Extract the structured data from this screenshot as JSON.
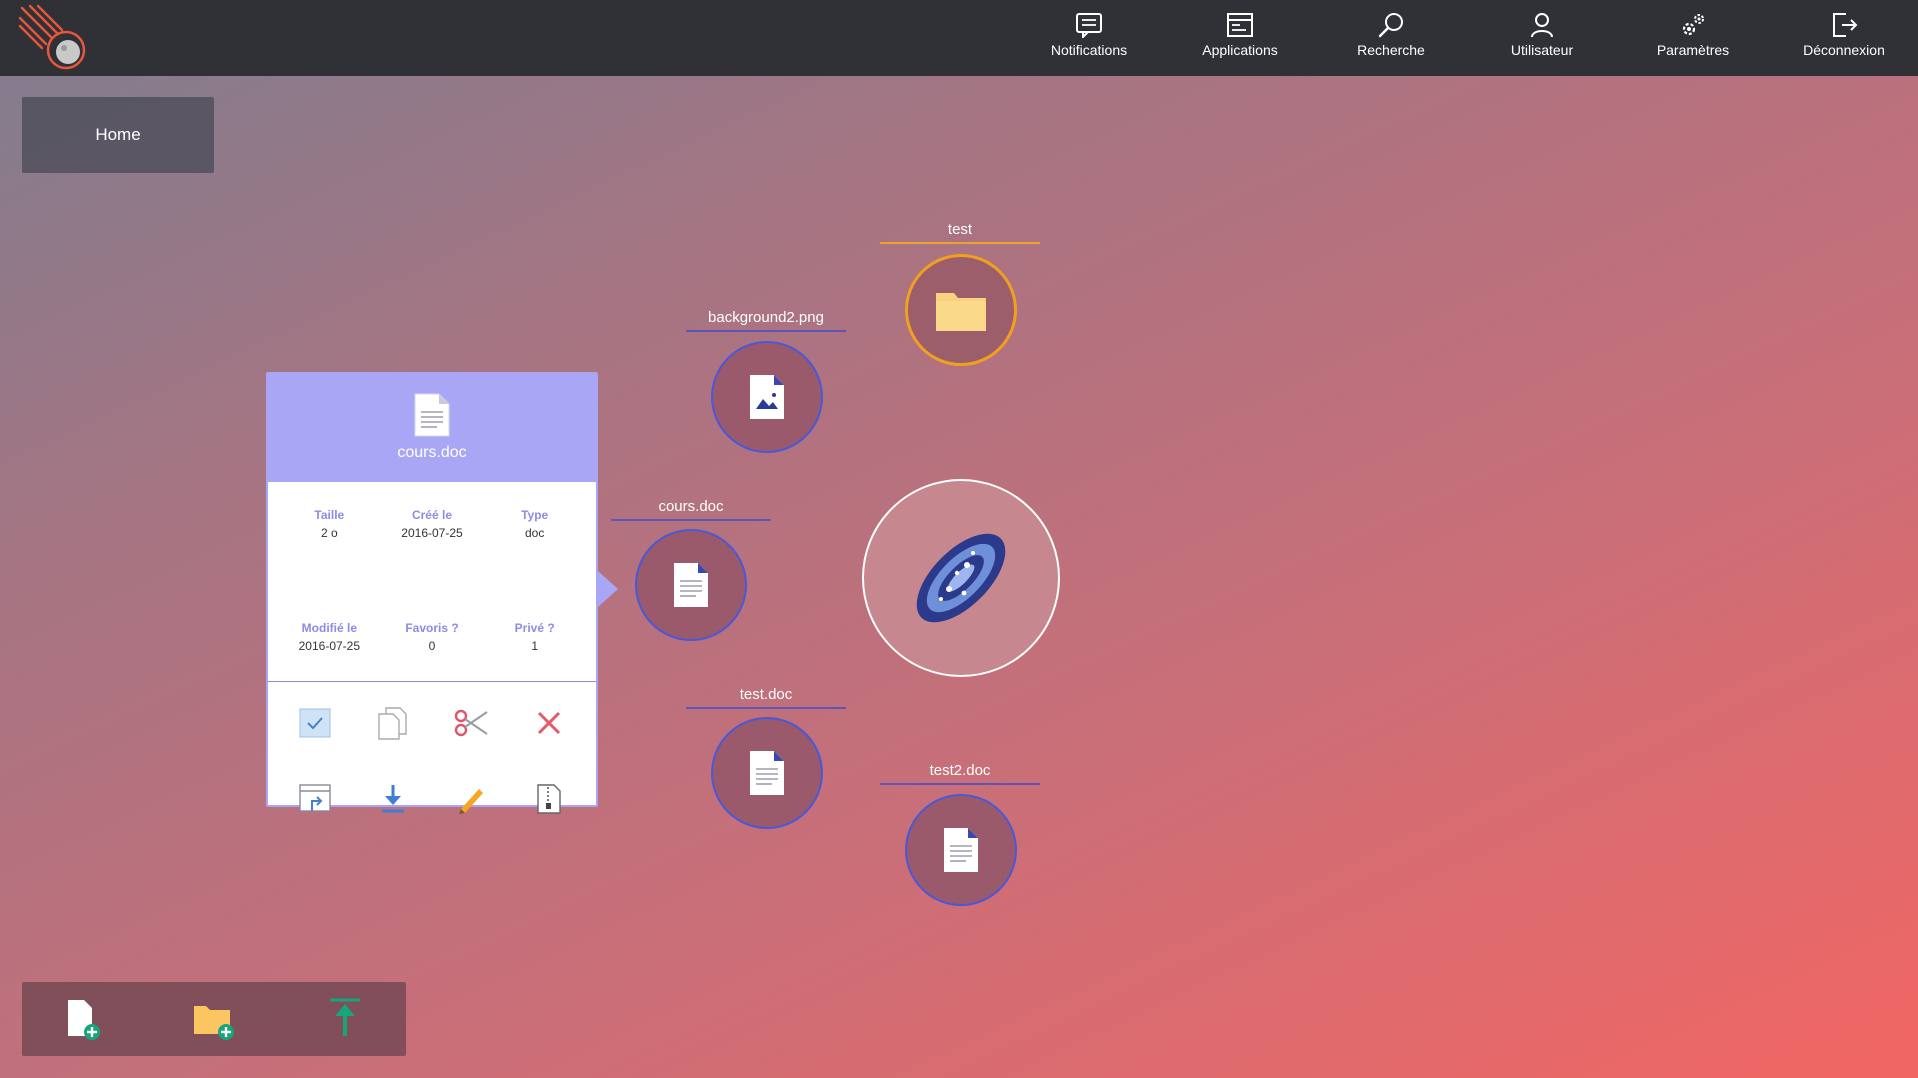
{
  "nav": {
    "items": [
      {
        "label": "Notifications",
        "icon": "notifications-icon"
      },
      {
        "label": "Applications",
        "icon": "applications-icon"
      },
      {
        "label": "Recherche",
        "icon": "search-icon"
      },
      {
        "label": "Utilisateur",
        "icon": "user-icon"
      },
      {
        "label": "Paramètres",
        "icon": "settings-icon"
      },
      {
        "label": "Déconnexion",
        "icon": "logout-icon"
      }
    ]
  },
  "breadcrumb": {
    "home": "Home"
  },
  "nodes": {
    "test": "test",
    "background2": "background2.png",
    "cours": "cours.doc",
    "testdoc": "test.doc",
    "test2doc": "test2.doc"
  },
  "panel": {
    "title": "cours.doc",
    "meta": {
      "taille_k": "Taille",
      "taille_v": "2 o",
      "cree_k": "Créé le",
      "cree_v": "2016-07-25",
      "type_k": "Type",
      "type_v": "doc",
      "modifie_k": "Modifié le",
      "modifie_v": "2016-07-25",
      "favoris_k": "Favoris ?",
      "favoris_v": "0",
      "prive_k": "Privé ?",
      "prive_v": "1"
    }
  },
  "colors": {
    "accent": "#a9a6f5",
    "folder": "#f0a020",
    "node_border": "#4a58d8",
    "topbar": "#2f3137"
  }
}
